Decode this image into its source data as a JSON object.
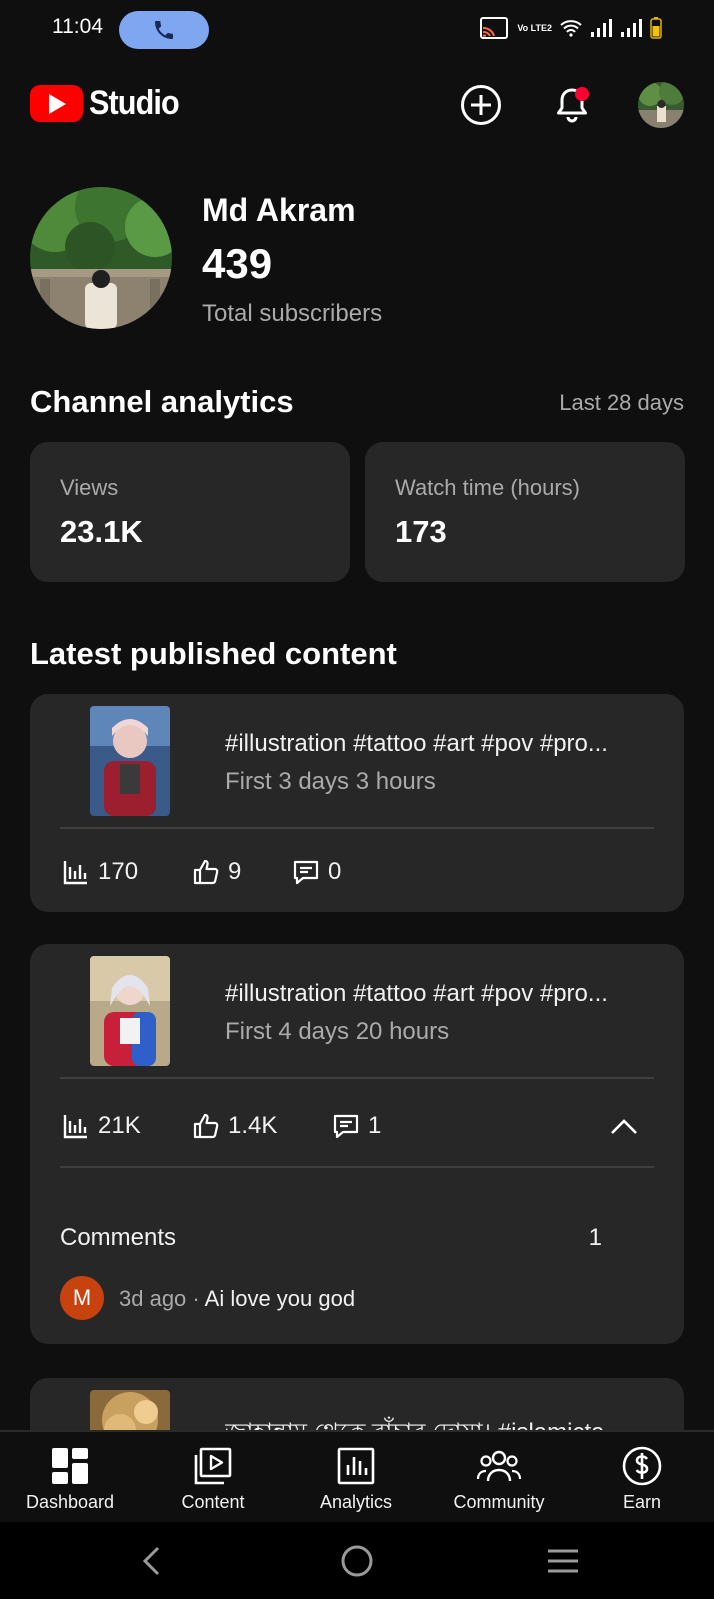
{
  "status_bar": {
    "time": "11:04",
    "network_label": "Vo LTE2"
  },
  "header": {
    "app_name": "Studio",
    "logo_icon": "youtube-play-icon",
    "create_icon": "plus-circle-icon",
    "notifications_icon": "bell-icon",
    "notification_dot_color": "#ff0033"
  },
  "profile": {
    "channel_name": "Md Akram",
    "subscriber_count": "439",
    "subscriber_label": "Total subscribers"
  },
  "analytics": {
    "title": "Channel analytics",
    "period": "Last 28 days",
    "stats": [
      {
        "label": "Views",
        "value": "23.1K"
      },
      {
        "label": "Watch time (hours)",
        "value": "173"
      }
    ]
  },
  "latest": {
    "title": "Latest published content",
    "items": [
      {
        "title": "#illustration #tattoo #art #pov #pro...",
        "subtitle": "First 3 days 3 hours",
        "views": "170",
        "likes": "9",
        "comments": "0"
      },
      {
        "title": "#illustration #tattoo #art #pov #pro...",
        "subtitle": "First 4 days 20 hours",
        "views": "21K",
        "likes": "1.4K",
        "comments": "1",
        "comments_section": {
          "label": "Comments",
          "count": "1",
          "comment": {
            "avatar_letter": "M",
            "meta": "3d ago · ",
            "text": "Ai love you god"
          }
        }
      },
      {
        "title": "জাহান্নাম থেকে বাঁচার দোয়া। #islamicta"
      }
    ]
  },
  "bottom_nav": {
    "items": [
      {
        "label": "Dashboard",
        "icon": "dashboard-icon"
      },
      {
        "label": "Content",
        "icon": "content-icon"
      },
      {
        "label": "Analytics",
        "icon": "analytics-icon"
      },
      {
        "label": "Community",
        "icon": "community-icon"
      },
      {
        "label": "Earn",
        "icon": "dollar-icon"
      }
    ]
  },
  "colors": {
    "background": "#0f0f0f",
    "card": "#272727",
    "brand_red": "#ff0000",
    "secondary_text": "#aaaaaa"
  }
}
